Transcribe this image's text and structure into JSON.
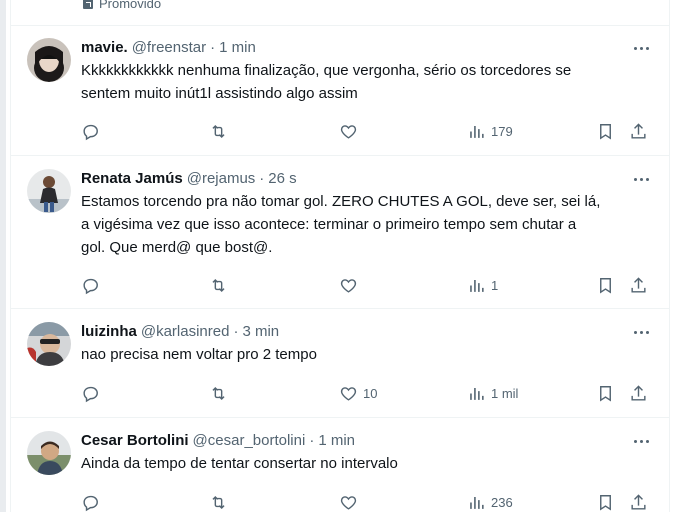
{
  "promo": {
    "label": "Promovido"
  },
  "tweets": [
    {
      "name": "mavie.",
      "handle": "@freenstar",
      "separator": "·",
      "time": "1 min",
      "text": "Kkkkkkkkkkkk nenhuma finalização,  que vergonha, sério os torcedores se\nsentem muito inút1l assistindo algo assim",
      "replies": "",
      "retweets": "",
      "likes": "",
      "views": "179"
    },
    {
      "name": "Renata Jamús",
      "handle": "@rejamus",
      "separator": "·",
      "time": "26 s",
      "text": "Estamos torcendo pra não tomar gol. ZERO CHUTES A GOL, deve ser, sei lá,\na vigésima vez que isso acontece: terminar o primeiro tempo sem chutar a\ngol. Que merd@ que bost@.",
      "replies": "",
      "retweets": "",
      "likes": "",
      "views": "1"
    },
    {
      "name": "luizinha",
      "handle": "@karlasinred",
      "separator": "·",
      "time": "3 min",
      "text": "nao precisa nem voltar pro 2 tempo",
      "replies": "",
      "retweets": "",
      "likes": "10",
      "views": "1 mil"
    },
    {
      "name": "Cesar Bortolini",
      "handle": "@cesar_bortolini",
      "separator": "·",
      "time": "1 min",
      "text": "Ainda da tempo de tentar consertar no intervalo",
      "replies": "",
      "retweets": "",
      "likes": "",
      "views": "236"
    }
  ],
  "icons": {
    "reply": "reply-icon",
    "retweet": "retweet-icon",
    "like": "heart-icon",
    "views": "views-icon",
    "bookmark": "bookmark-icon",
    "share": "share-icon",
    "more": "more-icon"
  },
  "colors": {
    "text": "#0f1419",
    "secondary": "#536471",
    "border": "#eff3f4"
  }
}
